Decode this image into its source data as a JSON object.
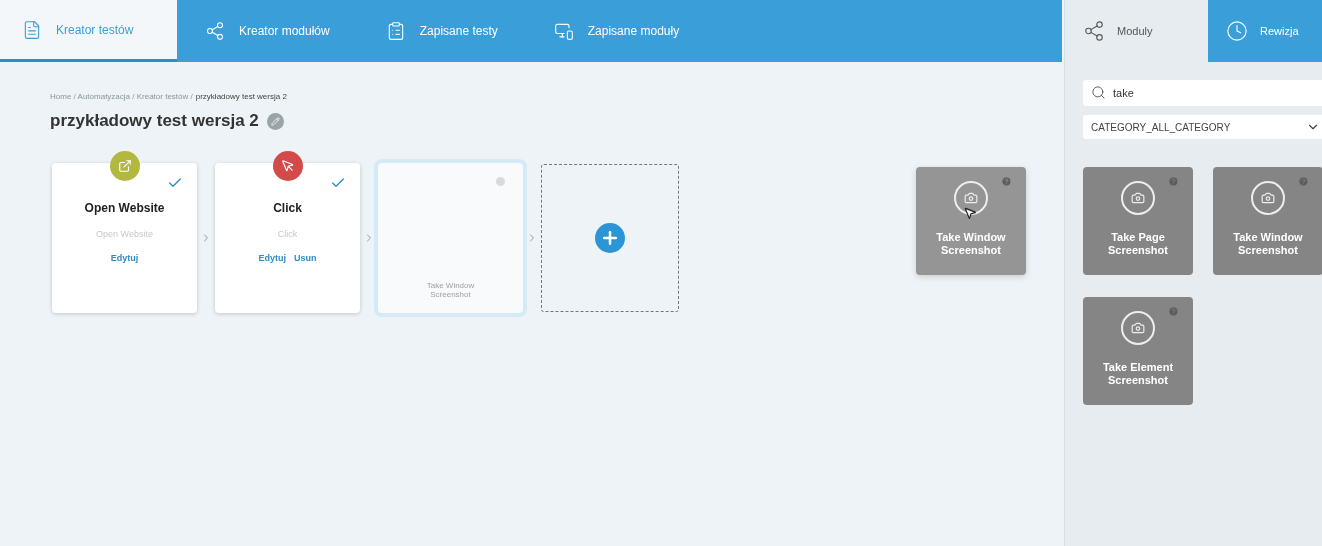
{
  "tabs": [
    {
      "label": "Kreator testów",
      "selected": true
    },
    {
      "label": "Kreator modułów",
      "selected": false
    },
    {
      "label": "Zapisane testy",
      "selected": false
    },
    {
      "label": "Zapisane moduły",
      "selected": false
    }
  ],
  "breadcrumb": {
    "path": "Home / Automatyzacja / Kreator testów /",
    "current": "przykładowy test wersja 2"
  },
  "title": "przykładowy test wersja 2",
  "steps": [
    {
      "kind": "module",
      "title": "Open Website",
      "subtitle": "Open Website",
      "color": "#b3b83e",
      "done": true,
      "actions": [
        "Edytuj"
      ]
    },
    {
      "kind": "module",
      "title": "Click",
      "subtitle": "Click",
      "color": "#d34a4a",
      "done": true,
      "actions": [
        "Edytuj",
        "Usun"
      ]
    },
    {
      "kind": "drop_target",
      "label": "Take Window Screenshot"
    },
    {
      "kind": "add"
    }
  ],
  "dragged_module": {
    "label": "Take Window Screenshot"
  },
  "sidebar": {
    "tabs": [
      {
        "label": "Moduly",
        "selected": true
      },
      {
        "label": "Rewizja",
        "selected": false
      }
    ],
    "search": {
      "value": "take"
    },
    "category": {
      "value": "CATEGORY_ALL_CATEGORY"
    },
    "modules": [
      {
        "label": "Take Page Screenshot"
      },
      {
        "label": "Take Window Screenshot"
      },
      {
        "label": "Take Element Screenshot"
      }
    ]
  }
}
